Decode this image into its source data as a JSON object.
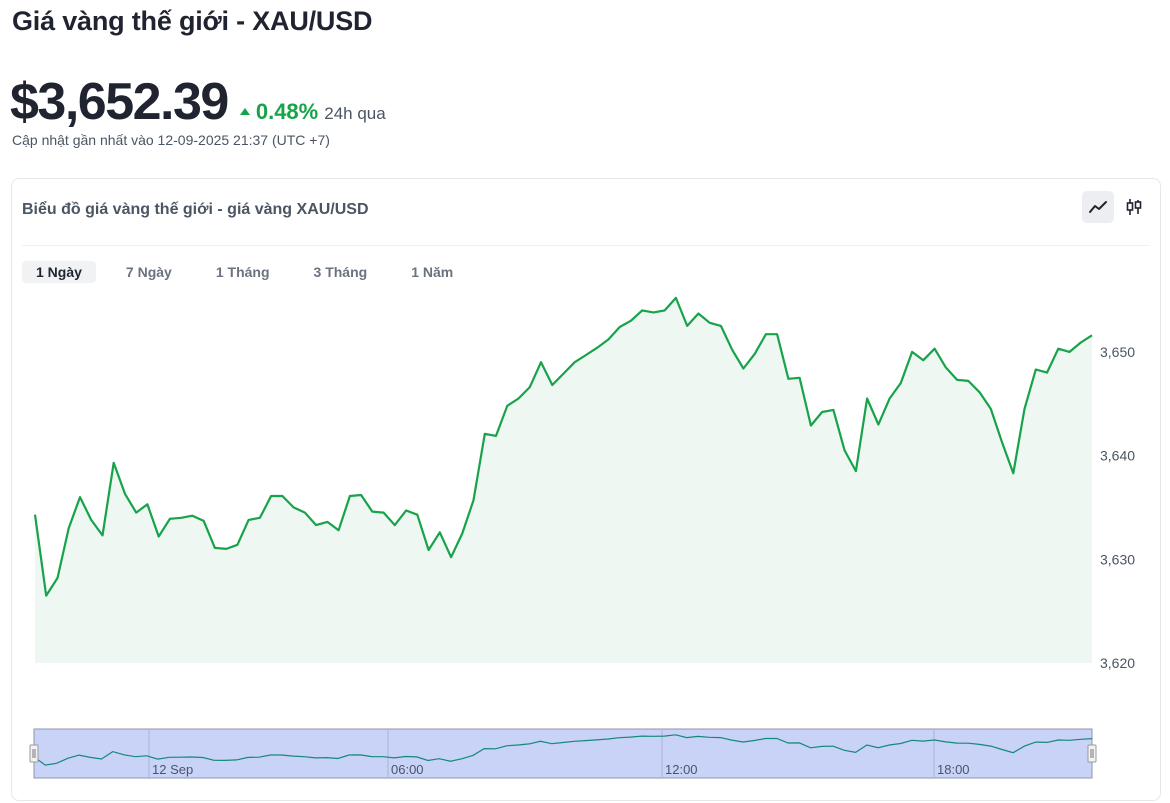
{
  "header": {
    "title": "Giá vàng thế giới - XAU/USD",
    "price": "$3,652.39",
    "change_pct": "0.48%",
    "change_period": "24h qua",
    "updated": "Cập nhật gần nhất vào 12-09-2025 21:37 (UTC +7)"
  },
  "card": {
    "title": "Biểu đồ giá vàng thế giới - giá vàng XAU/USD",
    "line_view_icon": "line-chart-icon",
    "candle_view_icon": "candlestick-icon"
  },
  "tabs": [
    {
      "label": "1 Ngày",
      "active": true
    },
    {
      "label": "7 Ngày",
      "active": false
    },
    {
      "label": "1 Tháng",
      "active": false
    },
    {
      "label": "3 Tháng",
      "active": false
    },
    {
      "label": "1 Năm",
      "active": false
    }
  ],
  "colors": {
    "line": "#16a34a",
    "area": "#eef7f1",
    "navigator_fill": "#c9d2f7",
    "navigator_border": "#8e96a8",
    "positive": "#16a34a"
  },
  "chart_data": {
    "type": "area",
    "ylim": [
      3620,
      3655
    ],
    "y_ticks": [
      3620,
      3630,
      3640,
      3650
    ],
    "y_tick_labels": [
      "3,620",
      "3,630",
      "3,640",
      "3,650"
    ],
    "values": [
      3634.3,
      3626.5,
      3628.2,
      3633.0,
      3636.0,
      3633.8,
      3632.3,
      3639.3,
      3636.3,
      3634.5,
      3635.3,
      3632.2,
      3633.9,
      3634.0,
      3634.2,
      3633.7,
      3631.1,
      3631.0,
      3631.4,
      3633.8,
      3634.0,
      3636.1,
      3636.1,
      3635.0,
      3634.5,
      3633.3,
      3633.6,
      3632.8,
      3636.1,
      3636.2,
      3634.6,
      3634.5,
      3633.3,
      3634.7,
      3634.3,
      3630.9,
      3632.6,
      3630.2,
      3632.5,
      3635.7,
      3642.1,
      3641.9,
      3644.8,
      3645.5,
      3646.6,
      3649.0,
      3646.8,
      3647.9,
      3649.0,
      3649.7,
      3650.4,
      3651.2,
      3652.4,
      3653.0,
      3654.0,
      3653.8,
      3654.0,
      3655.2,
      3652.5,
      3653.7,
      3652.8,
      3652.5,
      3650.2,
      3648.4,
      3649.8,
      3651.7,
      3651.7,
      3647.4,
      3647.5,
      3642.9,
      3644.2,
      3644.4,
      3640.5,
      3638.5,
      3645.5,
      3643.0,
      3645.5,
      3647.0,
      3650.0,
      3649.2,
      3650.3,
      3648.5,
      3647.3,
      3647.2,
      3646.1,
      3644.5,
      3641.3,
      3638.3,
      3644.5,
      3648.3,
      3648.0,
      3650.3,
      3650.0,
      3650.9,
      3651.6
    ],
    "navigator_labels": [
      "12 Sep",
      "06:00",
      "12:00",
      "18:00"
    ]
  }
}
